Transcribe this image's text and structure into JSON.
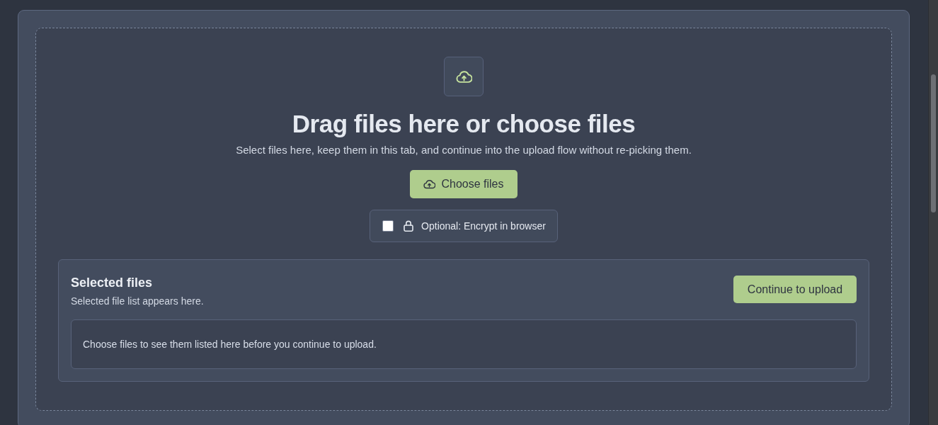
{
  "dropzone": {
    "title": "Drag files here or choose files",
    "description": "Select files here, keep them in this tab, and continue into the upload flow without re-picking them.",
    "choose_button": "Choose files",
    "encrypt_option": {
      "label": "Optional: Encrypt in browser",
      "checked": false
    }
  },
  "selected_files": {
    "title": "Selected files",
    "subtitle": "Selected file list appears here.",
    "continue_button": "Continue to upload",
    "empty_message": "Choose files to see them listed here before you continue to upload."
  }
}
